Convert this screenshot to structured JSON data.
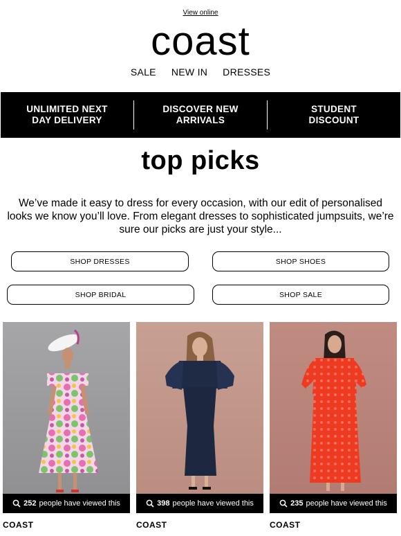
{
  "header": {
    "view_online": "View online",
    "logo": "coast",
    "nav": [
      "SALE",
      "NEW IN",
      "DRESSES"
    ]
  },
  "promo_bar": {
    "items": [
      "UNLIMITED NEXT\nDAY DELIVERY",
      "DISCOVER NEW\nARRIVALS",
      "STUDENT\nDISCOUNT"
    ]
  },
  "main": {
    "heading": "top picks",
    "intro": "We’ve made it easy to dress for every occasion, with our edit of personalised looks we know you’ll love. From elegant dresses to sophisticated jumpsuits, we’re sure our picks are just your style...",
    "buttons": [
      "SHOP DRESSES",
      "SHOP SHOES",
      "SHOP BRIDAL",
      "SHOP SALE"
    ]
  },
  "products": [
    {
      "views_count": "252",
      "views_suffix": "people have viewed this",
      "brand": "COAST",
      "icon": "search-icon",
      "bg": "#9a9a9c",
      "dress": "#e58fbf"
    },
    {
      "views_count": "398",
      "views_suffix": "people have viewed this",
      "brand": "COAST",
      "icon": "search-icon",
      "bg": "#c49a8c",
      "dress": "#1d2840"
    },
    {
      "views_count": "235",
      "views_suffix": "people have viewed this",
      "brand": "COAST",
      "icon": "search-icon",
      "bg": "#b9837a",
      "dress": "#ef3a22"
    }
  ]
}
